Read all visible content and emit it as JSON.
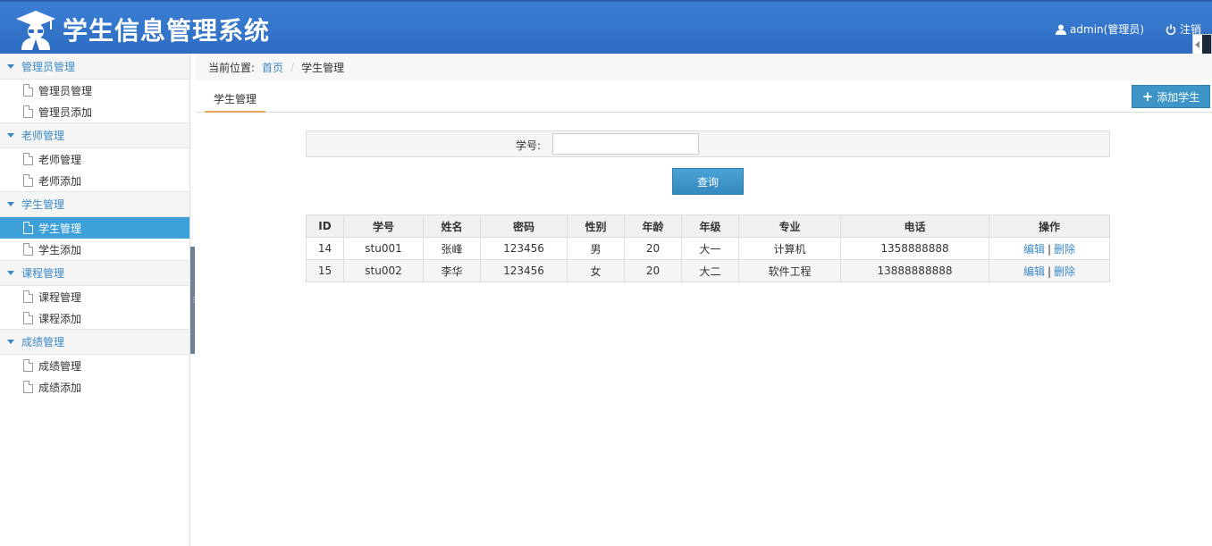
{
  "header": {
    "title": "学生信息管理系统",
    "user_label": "admin(管理员)",
    "logout_label": "注销"
  },
  "sidebar": {
    "groups": [
      {
        "title": "管理员管理",
        "items": [
          "管理员管理",
          "管理员添加"
        ]
      },
      {
        "title": "老师管理",
        "items": [
          "老师管理",
          "老师添加"
        ]
      },
      {
        "title": "学生管理",
        "items": [
          "学生管理",
          "学生添加"
        ]
      },
      {
        "title": "课程管理",
        "items": [
          "课程管理",
          "课程添加"
        ]
      },
      {
        "title": "成绩管理",
        "items": [
          "成绩管理",
          "成绩添加"
        ]
      }
    ],
    "active_item": "学生管理"
  },
  "breadcrumb": {
    "prefix": "当前位置:",
    "home": "首页",
    "separator": "/",
    "current": "学生管理"
  },
  "tab": {
    "label": "学生管理"
  },
  "add_button": {
    "label": "添加学生"
  },
  "search": {
    "label": "学号:",
    "value": "",
    "button_label": "查询"
  },
  "table": {
    "columns": [
      "ID",
      "学号",
      "姓名",
      "密码",
      "性别",
      "年龄",
      "年级",
      "专业",
      "电话",
      "操作"
    ],
    "rows": [
      {
        "id": "14",
        "sno": "stu001",
        "name": "张峰",
        "password": "123456",
        "gender": "男",
        "age": "20",
        "grade": "大一",
        "major": "计算机",
        "phone": "1358888888"
      },
      {
        "id": "15",
        "sno": "stu002",
        "name": "李华",
        "password": "123456",
        "gender": "女",
        "age": "20",
        "grade": "大二",
        "major": "软件工程",
        "phone": "13888888888"
      }
    ],
    "edit_label": "编辑",
    "delete_label": "删除",
    "op_separator": "|"
  }
}
